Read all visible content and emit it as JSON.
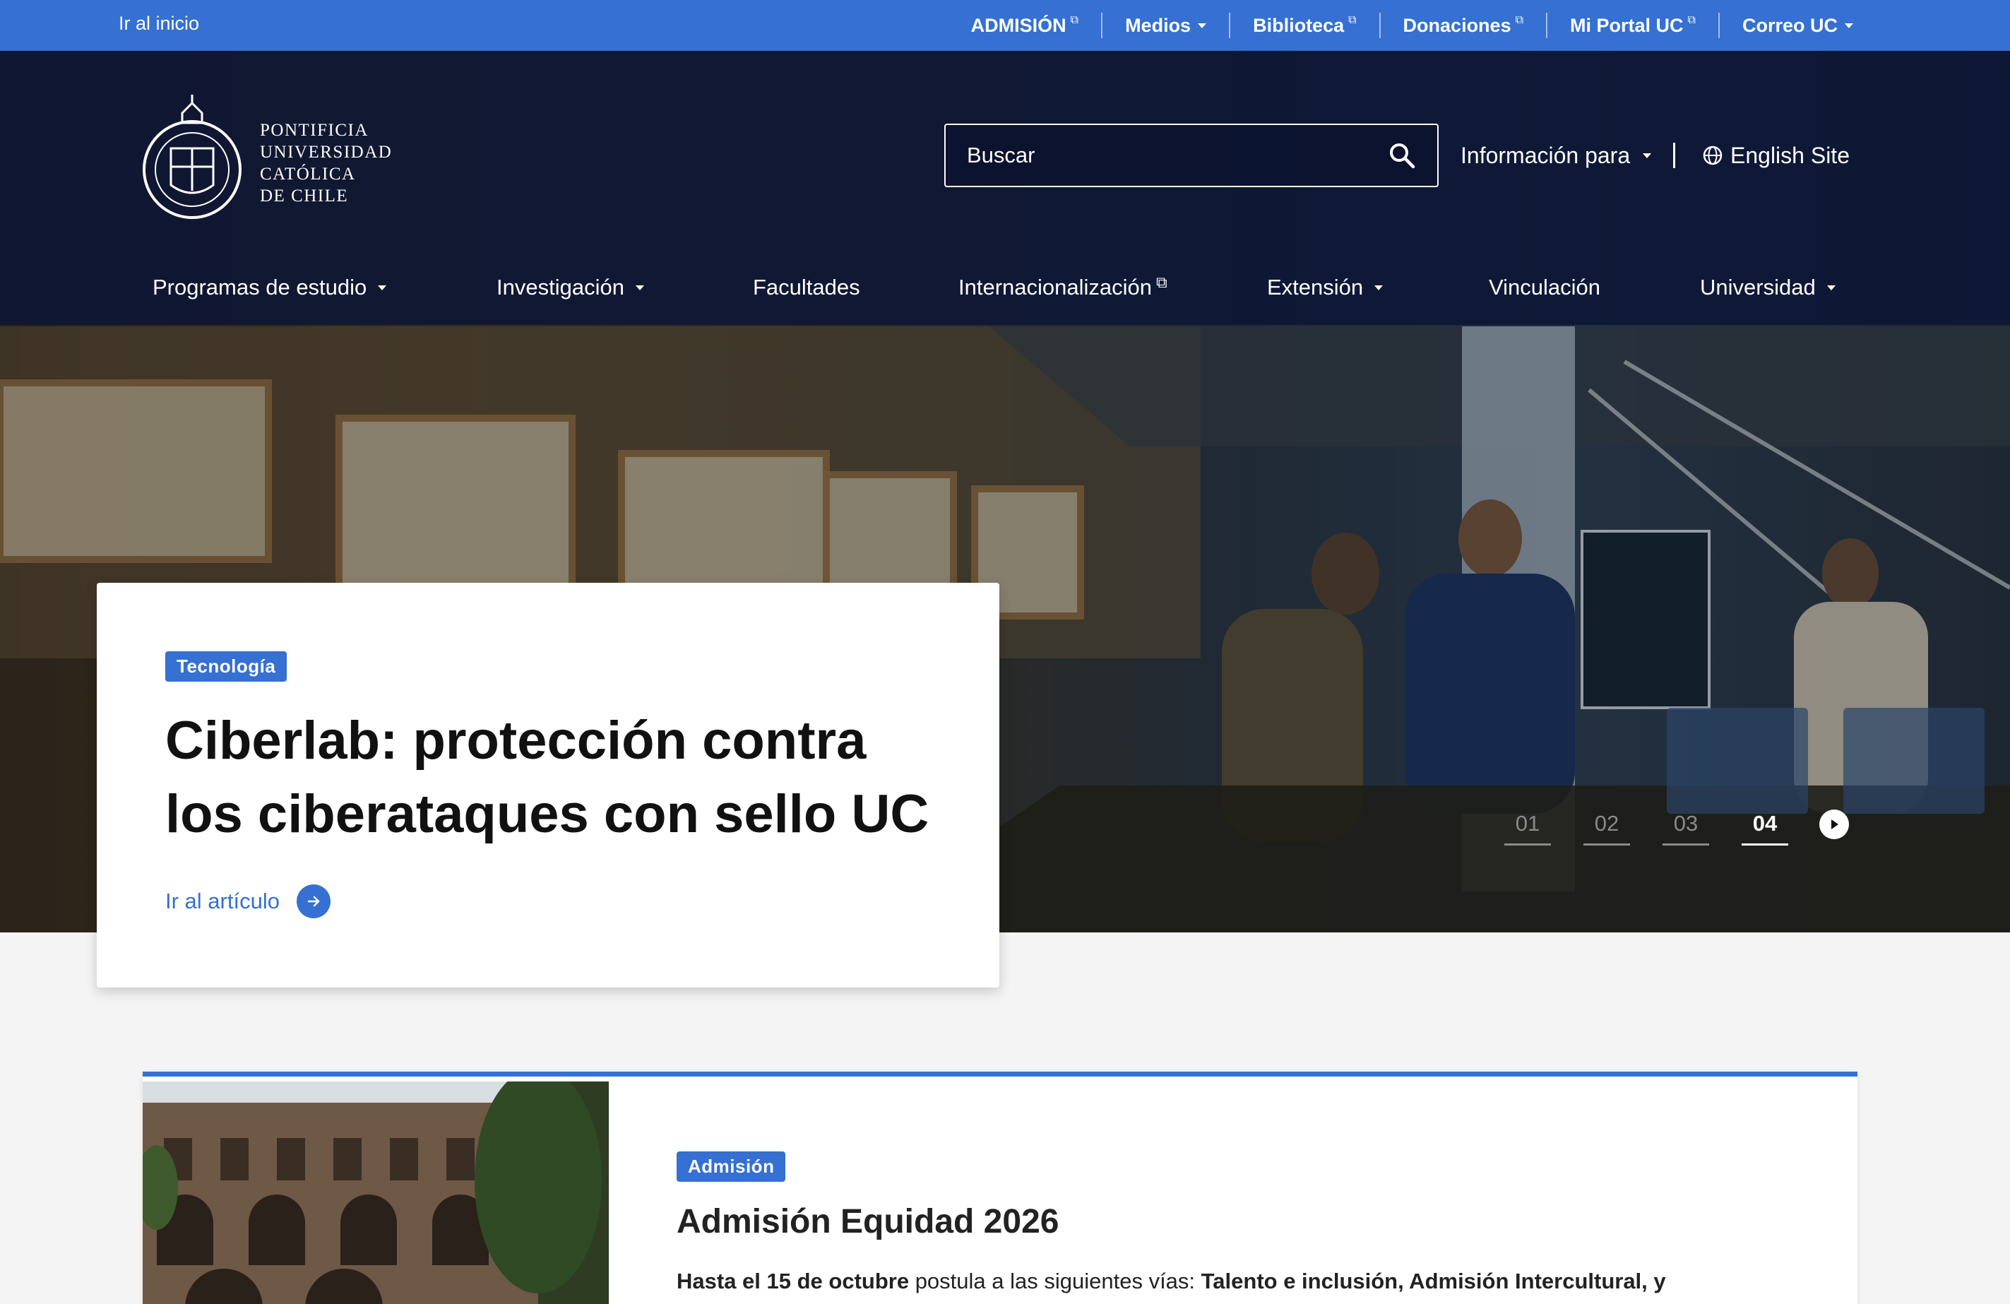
{
  "topbar": {
    "home_label": "Ir al inicio",
    "links": [
      {
        "label": "ADMISIÓN",
        "icon": "external-link-icon"
      },
      {
        "label": "Medios",
        "icon": "caret-down-icon"
      },
      {
        "label": "Biblioteca",
        "icon": "external-link-icon"
      },
      {
        "label": "Donaciones",
        "icon": "external-link-icon"
      },
      {
        "label": "Mi Portal UC",
        "icon": "external-link-icon"
      },
      {
        "label": "Correo UC",
        "icon": "caret-down-icon"
      }
    ],
    "bg_color": "#3570d2"
  },
  "header": {
    "logo_text": [
      "PONTIFICIA",
      "UNIVERSIDAD",
      "CATÓLICA",
      "DE CHILE"
    ],
    "search_placeholder": "Buscar",
    "info_para": "Información para",
    "english_site": "English Site",
    "nav": [
      {
        "label": "Programas de estudio",
        "icon": "caret-down-icon"
      },
      {
        "label": "Investigación",
        "icon": "caret-down-icon"
      },
      {
        "label": "Facultades"
      },
      {
        "label": "Internacionalización",
        "icon": "external-link-icon"
      },
      {
        "label": "Extensión",
        "icon": "caret-down-icon"
      },
      {
        "label": "Vinculación"
      },
      {
        "label": "Universidad",
        "icon": "caret-down-icon"
      }
    ]
  },
  "hero": {
    "tag": "Tecnología",
    "title": "Ciberlab: protección contra los ciberataques con sello UC",
    "cta": "Ir al artículo",
    "slides": [
      "01",
      "02",
      "03",
      "04"
    ],
    "active_slide": "04"
  },
  "feature": {
    "tag": "Admisión",
    "title": "Admisión Equidad 2026",
    "text_bold1": "Hasta el 15 de octubre",
    "text_normal": " postula a las siguientes vías: ",
    "text_bold2": "Talento e inclusión, Admisión Intercultural, y"
  }
}
